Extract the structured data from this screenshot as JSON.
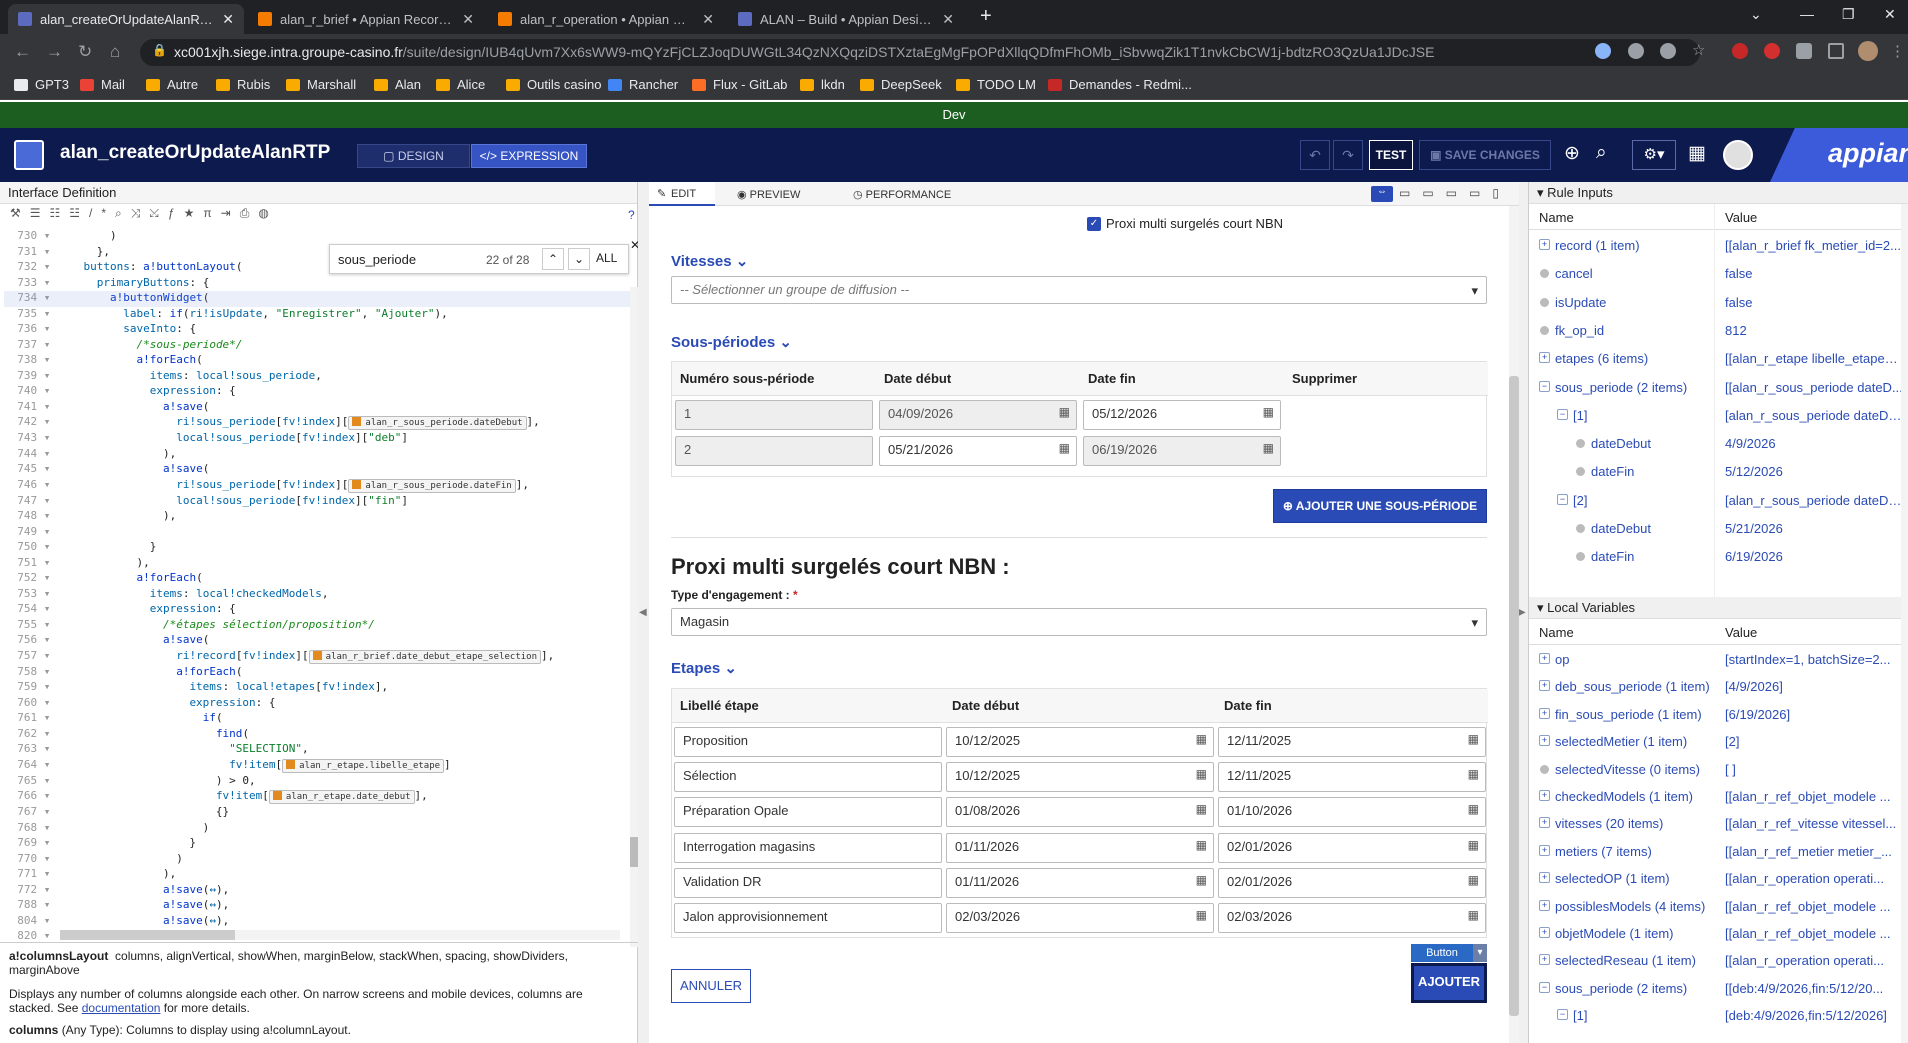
{
  "browser": {
    "tabs": [
      {
        "title": "alan_createOrUpdateAlanRTP • A",
        "active": true,
        "favicon_color": "#5c6bc0"
      },
      {
        "title": "alan_r_brief • Appian Record Typ",
        "active": false,
        "favicon_color": "#f57c00"
      },
      {
        "title": "alan_r_operation • Appian Recorc",
        "active": false,
        "favicon_color": "#f57c00"
      },
      {
        "title": "ALAN – Build • Appian Designer",
        "active": false,
        "favicon_color": "#5c6bc0"
      }
    ],
    "url_host": "xc001xjh.siege.intra.groupe-casino.fr",
    "url_path": "/suite/design/IUB4qUvm7Xx6sWW9-mQYzFjCLZJoqDUWGtL34QzNXQqziDSTXztaEgMgFpOPdXllqQDfmFhOMb_iSbvwqZik1T1nvkCbCW1j-bdtzRO3QzUa1JDcJSE",
    "bookmarks": [
      "GPT3",
      "Mail",
      "Autre",
      "Rubis",
      "Marshall",
      "Alan",
      "Alice",
      "Outils casino",
      "Rancher",
      "Flux - GitLab",
      "lkdn",
      "DeepSeek",
      "TODO LM",
      "Demandes - Redmi..."
    ]
  },
  "env_label": "Dev",
  "header": {
    "object_name": "alan_createOrUpdateAlanRTP",
    "mode_design": "DESIGN",
    "mode_expression": "EXPRESSION",
    "test_label": "TEST",
    "save_label": "SAVE CHANGES",
    "brand": "appian"
  },
  "left": {
    "title": "Interface Definition",
    "search_value": "sous_periode",
    "search_count": "22 of 28",
    "search_all": "ALL",
    "help_title": "a!columnsLayout",
    "help_params": "columns, alignVertical, showWhen, marginBelow, stackWhen, spacing, showDividers, marginAbove",
    "help_desc": "Displays any number of columns alongside each other. On narrow screens and mobile devices, columns are stacked. See",
    "help_link": "documentation",
    "help_desc2": "for more details.",
    "help_param_line": "columns",
    "help_param_type": "(Any Type): Columns to display using a!columnLayout."
  },
  "center": {
    "tab_edit": "EDIT",
    "tab_preview": "PREVIEW",
    "tab_performance": "PERFORMANCE",
    "checkbox_label": "Proxi multi surgelés court NBN",
    "vitesses_label": "Vitesses",
    "vitesses_placeholder": "-- Sélectionner un groupe de diffusion --",
    "sous_periodes_label": "Sous-périodes",
    "sp_headers": [
      "Numéro sous-période",
      "Date début",
      "Date fin",
      "Supprimer"
    ],
    "sp_rows": [
      {
        "num": "1",
        "debut": "04/09/2026",
        "fin": "05/12/2026"
      },
      {
        "num": "2",
        "debut": "05/21/2026",
        "fin": "06/19/2026"
      }
    ],
    "add_sp_label": "AJOUTER UNE SOUS-PÉRIODE",
    "section_title": "Proxi multi surgelés court NBN :",
    "engagement_label": "Type d'engagement :",
    "required_mark": "*",
    "engagement_value": "Magasin",
    "etapes_label": "Etapes",
    "etapes_headers": [
      "Libellé étape",
      "Date début",
      "Date fin"
    ],
    "etapes_rows": [
      {
        "libelle": "Proposition",
        "debut": "10/12/2025",
        "fin": "12/11/2025"
      },
      {
        "libelle": "Sélection",
        "debut": "10/12/2025",
        "fin": "12/11/2025"
      },
      {
        "libelle": "Préparation Opale",
        "debut": "01/08/2026",
        "fin": "01/10/2026"
      },
      {
        "libelle": "Interrogation magasins",
        "debut": "01/11/2026",
        "fin": "02/01/2026"
      },
      {
        "libelle": "Validation DR",
        "debut": "01/11/2026",
        "fin": "02/01/2026"
      },
      {
        "libelle": "Jalon approvisionnement",
        "debut": "02/03/2026",
        "fin": "02/03/2026"
      }
    ],
    "cancel_label": "ANNULER",
    "submit_label": "AJOUTER",
    "button_tag": "Button"
  },
  "right": {
    "rule_inputs_title": "Rule Inputs",
    "col_name": "Name",
    "col_value": "Value",
    "rule_inputs": [
      {
        "name": "record (1 item)",
        "value": "[[alan_r_brief fk_metier_id=2...",
        "kind": "plus",
        "indent": 0
      },
      {
        "name": "cancel",
        "value": "false",
        "kind": "dot",
        "indent": 0
      },
      {
        "name": "isUpdate",
        "value": "false",
        "kind": "dot",
        "indent": 0
      },
      {
        "name": "fk_op_id",
        "value": "812",
        "kind": "dot",
        "indent": 0
      },
      {
        "name": "etapes (6 items)",
        "value": "[[alan_r_etape libelle_etape=...",
        "kind": "plus",
        "indent": 0
      },
      {
        "name": "sous_periode (2 items)",
        "value": "[[alan_r_sous_periode dateD...",
        "kind": "minus",
        "indent": 0
      },
      {
        "name": "[1]",
        "value": "[alan_r_sous_periode dateDe...",
        "kind": "minus",
        "indent": 1
      },
      {
        "name": "dateDebut",
        "value": "4/9/2026",
        "kind": "dot",
        "indent": 2
      },
      {
        "name": "dateFin",
        "value": "5/12/2026",
        "kind": "dot",
        "indent": 2
      },
      {
        "name": "[2]",
        "value": "[alan_r_sous_periode dateDe...",
        "kind": "minus",
        "indent": 1
      },
      {
        "name": "dateDebut",
        "value": "5/21/2026",
        "kind": "dot",
        "indent": 2
      },
      {
        "name": "dateFin",
        "value": "6/19/2026",
        "kind": "dot",
        "indent": 2
      }
    ],
    "local_vars_title": "Local Variables",
    "local_vars": [
      {
        "name": "op",
        "value": "[startIndex=1, batchSize=2...",
        "kind": "plus",
        "indent": 0
      },
      {
        "name": "deb_sous_periode (1 item)",
        "value": "[4/9/2026]",
        "kind": "plus",
        "indent": 0
      },
      {
        "name": "fin_sous_periode (1 item)",
        "value": "[6/19/2026]",
        "kind": "plus",
        "indent": 0
      },
      {
        "name": "selectedMetier (1 item)",
        "value": "[2]",
        "kind": "plus",
        "indent": 0
      },
      {
        "name": "selectedVitesse (0 items)",
        "value": "[ ]",
        "kind": "dot",
        "indent": 0
      },
      {
        "name": "checkedModels (1 item)",
        "value": "[[alan_r_ref_objet_modele ...",
        "kind": "plus",
        "indent": 0
      },
      {
        "name": "vitesses (20 items)",
        "value": "[[alan_r_ref_vitesse vitessel...",
        "kind": "plus",
        "indent": 0
      },
      {
        "name": "metiers (7 items)",
        "value": "[[alan_r_ref_metier metier_...",
        "kind": "plus",
        "indent": 0
      },
      {
        "name": "selectedOP (1 item)",
        "value": "[[alan_r_operation operati...",
        "kind": "plus",
        "indent": 0
      },
      {
        "name": "possiblesModels (4 items)",
        "value": "[[alan_r_ref_objet_modele ...",
        "kind": "plus",
        "indent": 0
      },
      {
        "name": "objetModele (1 item)",
        "value": "[[alan_r_ref_objet_modele ...",
        "kind": "plus",
        "indent": 0
      },
      {
        "name": "selectedReseau (1 item)",
        "value": "[[alan_r_operation operati...",
        "kind": "plus",
        "indent": 0
      },
      {
        "name": "sous_periode (2 items)",
        "value": "[[deb:4/9/2026,fin:5/12/20...",
        "kind": "minus",
        "indent": 0
      },
      {
        "name": "[1]",
        "value": "[deb:4/9/2026,fin:5/12/2026]",
        "kind": "minus",
        "indent": 1
      }
    ]
  }
}
